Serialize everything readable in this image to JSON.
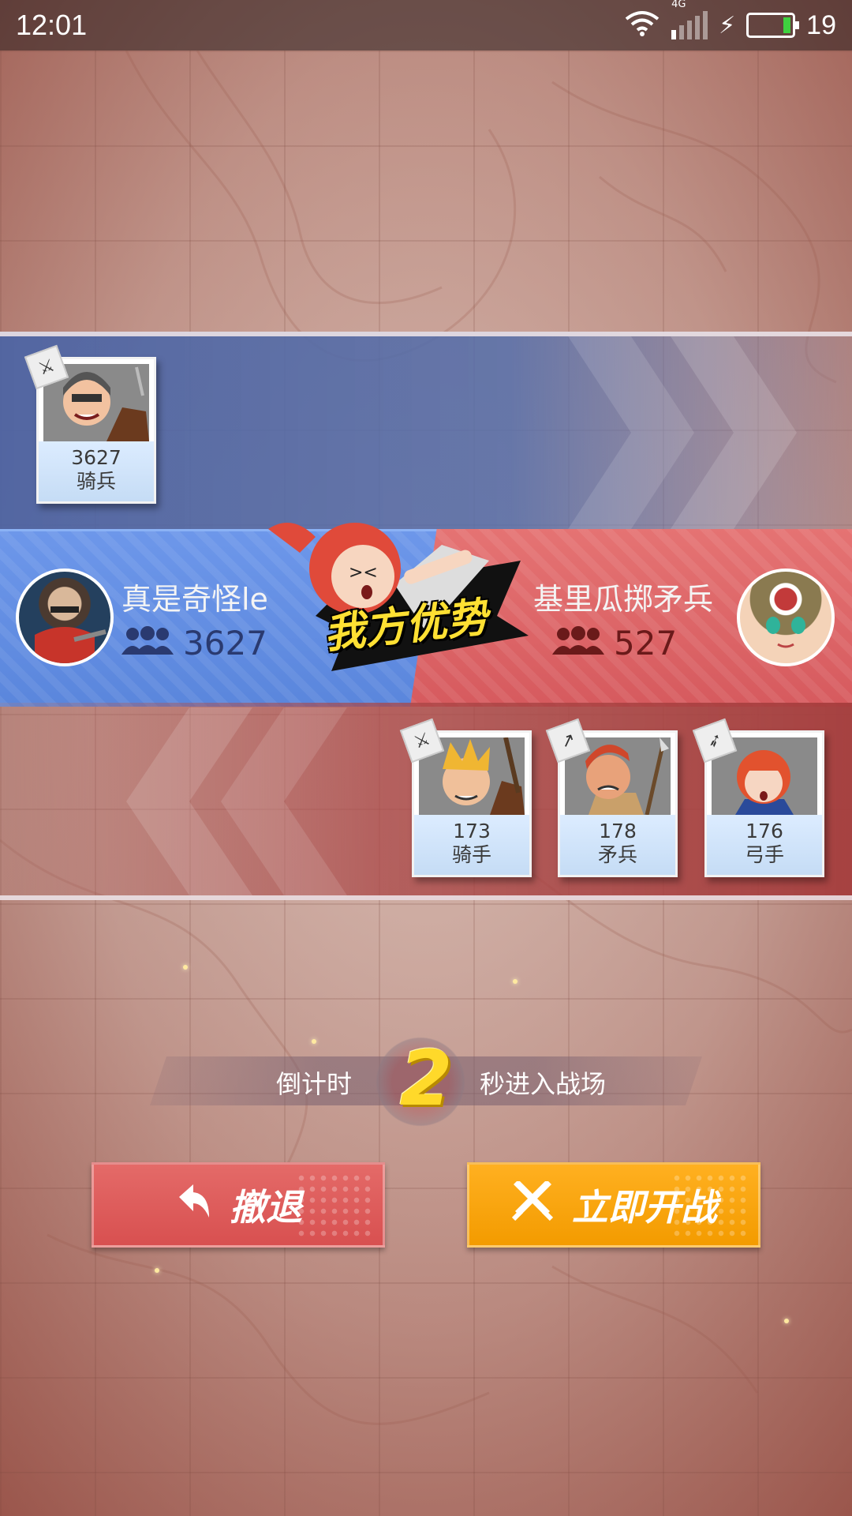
{
  "status_bar": {
    "time": "12:01",
    "network": "4G",
    "battery": "19"
  },
  "ally_units": [
    {
      "power": "3627",
      "name": "骑兵",
      "icon": "horse-knight-icon"
    }
  ],
  "enemy_units": [
    {
      "power": "173",
      "name": "骑手",
      "icon": "horse-rider-icon"
    },
    {
      "power": "178",
      "name": "矛兵",
      "icon": "spearman-icon"
    },
    {
      "power": "176",
      "name": "弓手",
      "icon": "archer-icon"
    }
  ],
  "ally_player": {
    "name": "真是奇怪le",
    "power": "3627",
    "color": "#5a86dc"
  },
  "enemy_player": {
    "name": "基里瓜掷矛兵",
    "power": "527",
    "color": "#d65a5e"
  },
  "advantage_badge": "我方优势",
  "countdown": {
    "prefix": "倒计时",
    "seconds": "2",
    "suffix": "秒进入战场"
  },
  "buttons": {
    "retreat": "撤退",
    "fight_now": "立即开战"
  },
  "colors": {
    "retreat": "#d85050",
    "fight": "#f39b00",
    "countdown_digit": "#ffd92a"
  }
}
